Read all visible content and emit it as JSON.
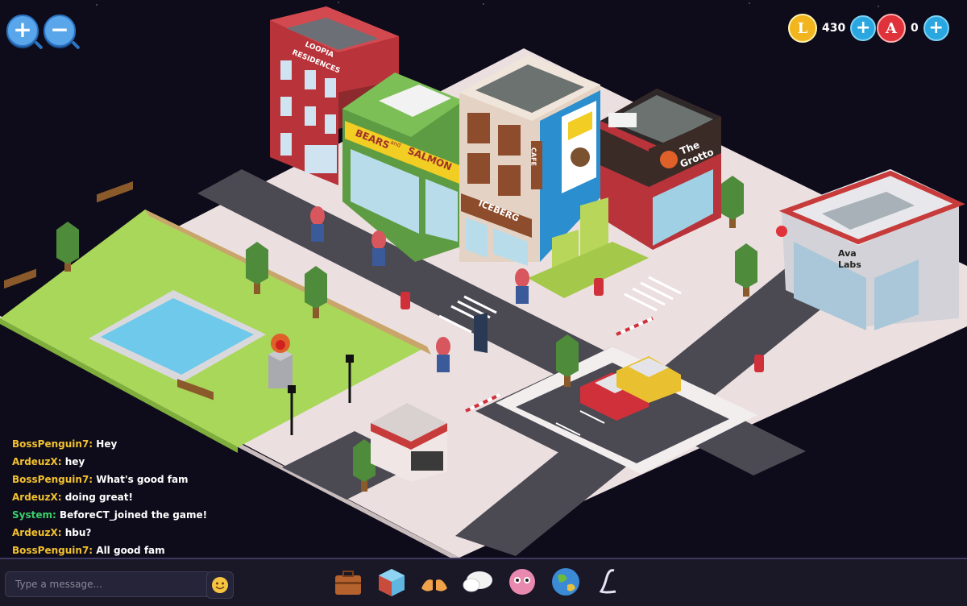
{
  "zoom": {
    "in_label": "+",
    "out_label": "−"
  },
  "currency": {
    "coins": {
      "value": "430",
      "icon": "L",
      "color": "#f2b51e"
    },
    "tokens": {
      "value": "0",
      "icon": "A",
      "color": "#e0323a"
    },
    "add_label": "+"
  },
  "buildings": {
    "loopia": {
      "line1": "LOOPIA",
      "line2": "RESIDENCES"
    },
    "bears": {
      "line1": "BEARS",
      "line2": "SALMON",
      "connector": "and"
    },
    "cafe": {
      "name": "ICEBERG",
      "cafe_label": "CAFE"
    },
    "grotto": {
      "line1": "The",
      "line2": "Grotto"
    },
    "ava": {
      "line1": "Ava",
      "line2": "Labs"
    }
  },
  "chat": {
    "messages": [
      {
        "user": "BossPenguin7:",
        "text": "Hey",
        "system": false
      },
      {
        "user": "ArdeuzX:",
        "text": "hey",
        "system": false
      },
      {
        "user": "BossPenguin7:",
        "text": "What's good fam",
        "system": false
      },
      {
        "user": "ArdeuzX:",
        "text": "doing great!",
        "system": false
      },
      {
        "user": "System:",
        "text": "BeforeCT_joined the game!",
        "system": true
      },
      {
        "user": "ArdeuzX:",
        "text": "hbu?",
        "system": false
      },
      {
        "user": "BossPenguin7:",
        "text": "All good fam",
        "system": false
      }
    ],
    "placeholder": "Type a message...",
    "emoji_icon": "smiley-icon"
  },
  "toolbar": {
    "items": [
      "briefcase-icon",
      "box-icon",
      "hands-icon",
      "chat-bubble-icon",
      "avatar-icon",
      "globe-icon",
      "loopia-logo-icon"
    ]
  }
}
